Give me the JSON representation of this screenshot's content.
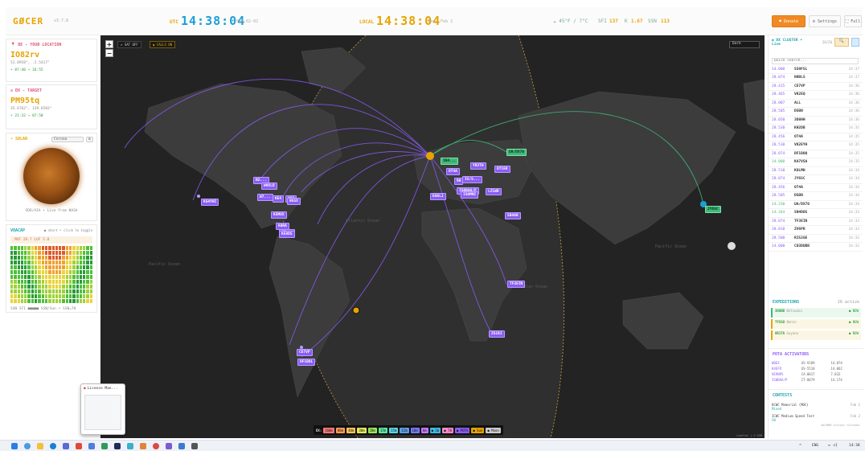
{
  "header": {
    "logo": "GØCER",
    "version": "v3.7.8",
    "utc_label": "UTC",
    "utc_time": "14:38:04",
    "utc_date": "2026-02-02",
    "local_label": "LOCAL",
    "local_time": "14:38:04",
    "local_date": "Mon, Feb 2",
    "weather": "☁ 45°F / 7°C",
    "sfi_label": "SFI",
    "sfi": "137",
    "k_label": "K",
    "k": "1.67",
    "ssn_label": "SSN",
    "ssn": "113",
    "donate": "♥ Donate",
    "settings": "⚙ Settings",
    "full": "⛶ Full"
  },
  "de": {
    "title": "DE - YOUR LOCATION",
    "grid": "IO82rv",
    "coords": "52.0958°, -2.5417°",
    "sun": "☀ 07:40 → 16:55"
  },
  "dx": {
    "title": "DX - TARGET",
    "grid": "PM95tq",
    "coords": "35.6762°, 139.6503°",
    "sun": "☀ 21:32 → 07:50"
  },
  "solar": {
    "title": "SOLAR",
    "select": "Corona",
    "caption": "SDO/AIA • Live from NASA"
  },
  "voacap": {
    "title": "VOACAP",
    "hint": "● short • click to toggle",
    "stats": "MUF 28.7  LUF 5.8",
    "footer": "SSN  SFI  ■■■■■  SSN/Sun • SSN=70"
  },
  "map": {
    "sat_off": "✕ SAT OFF",
    "calls_on": "◉ CALLS ON",
    "style": "Dark",
    "oceans": [
      "Pacific Ocean",
      "Atlantic Ocean",
      "Indian Ocean",
      "Pacific Ocean"
    ],
    "bands_label": "DX:",
    "bands": [
      "160m",
      "80m",
      "40m",
      "30m",
      "20m",
      "17m",
      "15m",
      "12m",
      "10m",
      "6m",
      "● 2m",
      "● 70",
      "● POTA",
      "● Sun",
      "● Moon"
    ],
    "band_colors": [
      "#ff7a7a",
      "#ff9f5a",
      "#ffc85a",
      "#e7e75a",
      "#9fe75a",
      "#5ae79f",
      "#5ad4e7",
      "#5a9fe7",
      "#7a7aff",
      "#c57aff",
      "#3fb9e7",
      "#ff8ac8",
      "#8b5cf6",
      "#e7a400",
      "#cccccc"
    ],
    "callsigns": [
      {
        "t": "KG4YHI",
        "c": "p"
      },
      {
        "t": "N2...",
        "c": "p"
      },
      {
        "t": "W9XLD",
        "c": "p"
      },
      {
        "t": "W7...",
        "c": "p"
      },
      {
        "t": "K5MOX",
        "c": "p"
      },
      {
        "t": "KE4",
        "c": "p"
      },
      {
        "t": "WA3",
        "c": "p"
      },
      {
        "t": "N5SX",
        "c": "p"
      },
      {
        "t": "K0RA",
        "c": "p"
      },
      {
        "t": "K6...",
        "c": "p"
      },
      {
        "t": "KE8DS",
        "c": "p"
      },
      {
        "t": "EA6LJ",
        "c": "p"
      },
      {
        "t": "OT4A",
        "c": "p"
      },
      {
        "t": "IB4...",
        "c": "g"
      },
      {
        "t": "YR3TH",
        "c": "p"
      },
      {
        "t": "OT1EK",
        "c": "p"
      },
      {
        "t": "UA/DX70",
        "c": "g"
      },
      {
        "t": "9A",
        "c": "p"
      },
      {
        "t": "IS/S...",
        "c": "p"
      },
      {
        "t": "IS0BAA/P",
        "c": "p"
      },
      {
        "t": "IS0MNI",
        "c": "p"
      },
      {
        "t": "LZ1WR",
        "c": "p"
      },
      {
        "t": "5B4AB",
        "c": "p"
      },
      {
        "t": "TF3EIN",
        "c": "p"
      },
      {
        "t": "ZS1RJ",
        "c": "p"
      },
      {
        "t": "CE7VP",
        "c": "p"
      },
      {
        "t": "DF1BOL",
        "c": "p"
      },
      {
        "t": "JY6SC",
        "c": "g"
      }
    ],
    "attribution": "Leaflet | © OSM"
  },
  "dx_cluster": {
    "title": "DX CLUSTER •",
    "subtitle": "Live",
    "count": "26/26",
    "search_placeholder": "Quick search...",
    "spots": [
      {
        "f": "14.000",
        "c": "SS9FSL",
        "t": "14:37",
        "g": false
      },
      {
        "f": "28.074",
        "c": "N9BLS",
        "t": "14:37",
        "g": false
      },
      {
        "f": "28.415",
        "c": "CE7VP",
        "t": "14:36",
        "g": false
      },
      {
        "f": "28.465",
        "c": "VK2EQ",
        "t": "14:36",
        "g": false
      },
      {
        "f": "28.007",
        "c": "ALL",
        "t": "14:36",
        "g": false
      },
      {
        "f": "28.505",
        "c": "D5BN",
        "t": "14:36",
        "g": false
      },
      {
        "f": "28.050",
        "c": "3D8HH",
        "t": "14:36",
        "g": false
      },
      {
        "f": "28.530",
        "c": "KH2DB",
        "t": "14:35",
        "g": false
      },
      {
        "f": "28.456",
        "c": "OT4A",
        "t": "14:35",
        "g": false
      },
      {
        "f": "28.510",
        "c": "VK2EYH",
        "t": "14:35",
        "g": false
      },
      {
        "f": "28.074",
        "c": "DF1BOQ",
        "t": "14:35",
        "g": false
      },
      {
        "f": "14.000",
        "c": "KA7VSA",
        "t": "14:35",
        "g": true
      },
      {
        "f": "28.510",
        "c": "KOLMH",
        "t": "14:34",
        "g": false
      },
      {
        "f": "28.074",
        "c": "JY6SC",
        "t": "14:34",
        "g": false
      },
      {
        "f": "28.456",
        "c": "OT4A",
        "t": "14:34",
        "g": false
      },
      {
        "f": "28.505",
        "c": "D5BN",
        "t": "14:34",
        "g": false
      },
      {
        "f": "14.230",
        "c": "UA/DX70",
        "t": "14:34",
        "g": true
      },
      {
        "f": "14.344",
        "c": "SN4DOS",
        "t": "14:33",
        "g": true
      },
      {
        "f": "28.074",
        "c": "TF3EIN",
        "t": "14:33",
        "g": false
      },
      {
        "f": "28.010",
        "c": "ZV6PR",
        "t": "14:33",
        "g": false
      },
      {
        "f": "28.500",
        "c": "RI52GE",
        "t": "14:33",
        "g": false
      },
      {
        "f": "14.000",
        "c": "CO3DUBB",
        "t": "14:33",
        "g": false
      }
    ]
  },
  "expeditions": {
    "title": "EXPEDITIONS",
    "count": "16 active",
    "items": [
      {
        "call": "3D8BB",
        "sub": "Botswana",
        "tag": "● NOW"
      },
      {
        "call": "TY5SO",
        "sub": "Benin",
        "tag": "● NOW"
      },
      {
        "call": "8R1TA",
        "sub": "Guyana",
        "tag": "● NOW"
      }
    ]
  },
  "pota": {
    "title": "POTA ACTIVATORS",
    "rows": [
      [
        "W0EX",
        "US-9189",
        "14.074"
      ],
      [
        "K4EFR",
        "US-5510",
        "14.062"
      ],
      [
        "VE9NPS",
        "CA-0017",
        "7.032"
      ],
      [
        "IS0BAA/P",
        "IT-0079",
        "14.174"
      ]
    ]
  },
  "contests": {
    "title": "CONTESTS",
    "items": [
      {
        "name": "KCWC Memorial (MOC)",
        "sub": "Mixed",
        "date": "Feb 1"
      },
      {
        "name": "ICWC Medium Speed Test",
        "sub": "CW",
        "date": "Feb 2"
      }
    ],
    "footer": "WA7BNM Contest Calendar"
  },
  "taskbar": {
    "thumb_title": "License Man...",
    "lang": "ENG",
    "time": "14:38"
  }
}
